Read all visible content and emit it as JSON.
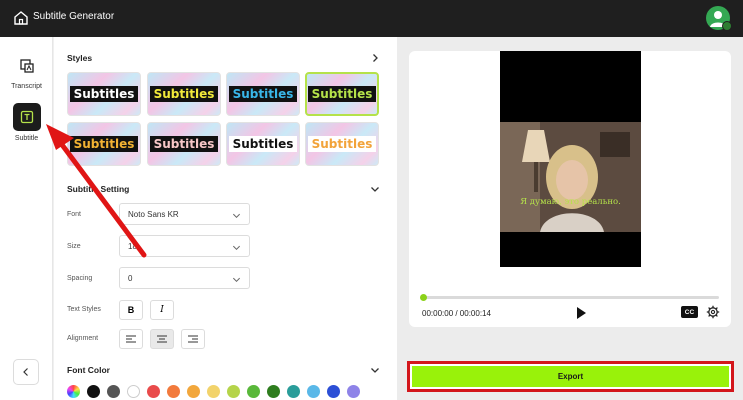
{
  "app": {
    "title": "Subtitle Generator"
  },
  "nav": {
    "transcript_label": "Transcript",
    "subtitle_label": "Subtitle"
  },
  "styles_section": {
    "heading": "Styles",
    "cards": [
      {
        "text": "Subtitles",
        "fg": "#ffffff",
        "bg": "#111111",
        "selected": false
      },
      {
        "text": "Subtitles",
        "fg": "#f2e93a",
        "bg": "#111111",
        "selected": false
      },
      {
        "text": "Subtitles",
        "fg": "#39b6e8",
        "bg": "#111111",
        "selected": false
      },
      {
        "text": "Subtitles",
        "fg": "#b5e24a",
        "bg": "#111111",
        "selected": true
      },
      {
        "text": "Subtitles",
        "fg": "#f2b233",
        "bg": "#111111",
        "selected": false
      },
      {
        "text": "Subtitles",
        "fg": "#f7c7c7",
        "bg": "#111111",
        "selected": false
      },
      {
        "text": "Subtitles",
        "fg": "#111111",
        "bg": "#ffffff",
        "selected": false
      },
      {
        "text": "Subtitles",
        "fg": "#f2a33a",
        "bg": "#ffffff",
        "selected": false
      }
    ]
  },
  "subtitle_setting": {
    "heading": "Subtitle Setting",
    "font_label": "Font",
    "font_value": "Noto Sans KR",
    "size_label": "Size",
    "size_value": "18",
    "spacing_label": "Spacing",
    "spacing_value": "0",
    "text_styles_label": "Text Styles",
    "bold_label": "B",
    "italic_label": "I",
    "alignment_label": "Alignment"
  },
  "font_color": {
    "heading": "Font Color",
    "swatches": [
      "rainbow",
      "#111111",
      "#555555",
      "#ffffff",
      "#e94b4b",
      "#f27a3c",
      "#f2a73c",
      "#f2d36b",
      "#b5d44a",
      "#59b83a",
      "#2e7d1e",
      "#2a9d9a",
      "#5ab8e8",
      "#2c4fd6",
      "#8e83e8"
    ]
  },
  "player": {
    "subtitle_text": "Я думаю, это реально.",
    "time_display": "00:00:00 / 00:00:14",
    "progress": 0.0,
    "cc_label": "CC"
  },
  "export": {
    "label": "Export"
  },
  "colors": {
    "accent": "#99f20a",
    "highlight_border": "#d3161b",
    "topbar": "#1f1f1f"
  }
}
